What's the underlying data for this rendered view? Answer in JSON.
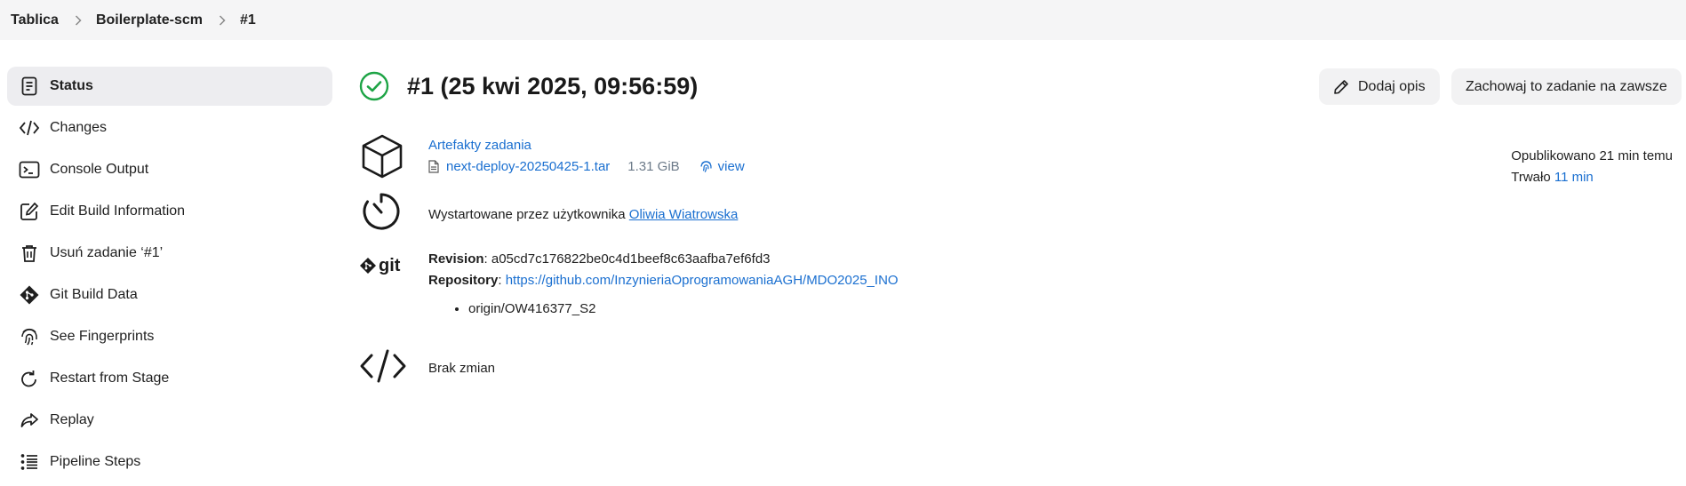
{
  "breadcrumb": {
    "items": [
      "Tablica",
      "Boilerplate-scm",
      "#1"
    ]
  },
  "sidebar": {
    "items": [
      {
        "label": "Status",
        "icon": "status-document-icon",
        "active": true
      },
      {
        "label": "Changes",
        "icon": "code-brackets-icon"
      },
      {
        "label": "Console Output",
        "icon": "terminal-icon"
      },
      {
        "label": "Edit Build Information",
        "icon": "edit-icon"
      },
      {
        "label": "Usuń zadanie ‘#1’",
        "icon": "trash-icon"
      },
      {
        "label": "Git Build Data",
        "icon": "git-icon"
      },
      {
        "label": "See Fingerprints",
        "icon": "fingerprint-icon"
      },
      {
        "label": "Restart from Stage",
        "icon": "restart-icon"
      },
      {
        "label": "Replay",
        "icon": "replay-icon"
      },
      {
        "label": "Pipeline Steps",
        "icon": "pipeline-steps-icon"
      }
    ]
  },
  "header": {
    "title": "#1 (25 kwi 2025, 09:56:59)",
    "status": "success",
    "add_description_label": "Dodaj opis",
    "keep_forever_label": "Zachowaj to zadanie na zawsze"
  },
  "artifacts": {
    "title": "Artefakty zadania",
    "file_name": "next-deploy-20250425-1.tar",
    "file_size": "1.31 GiB",
    "view_label": "view"
  },
  "started": {
    "text": "Wystartowane przez użytkownika",
    "user": "Oliwia Wiatrowska"
  },
  "git": {
    "logo_text": "git",
    "revision_label": "Revision",
    "revision_value": "a05cd7c176822be0c4d1beef8c63aafba7ef6fd3",
    "repository_label": "Repository",
    "repository_url": "https://github.com/InzynieriaOprogramowaniaAGH/MDO2025_INO",
    "branches": [
      "origin/OW416377_S2"
    ]
  },
  "changes": {
    "text": "Brak zmian"
  },
  "meta": {
    "published": "Opublikowano 21 min temu",
    "duration_label": "Trwało",
    "duration_value": "11 min"
  },
  "colors": {
    "link": "#1a6fd0",
    "success": "#1ea446",
    "active_bg": "#ededf0",
    "breadcrumb_bg": "#f5f5f6"
  }
}
